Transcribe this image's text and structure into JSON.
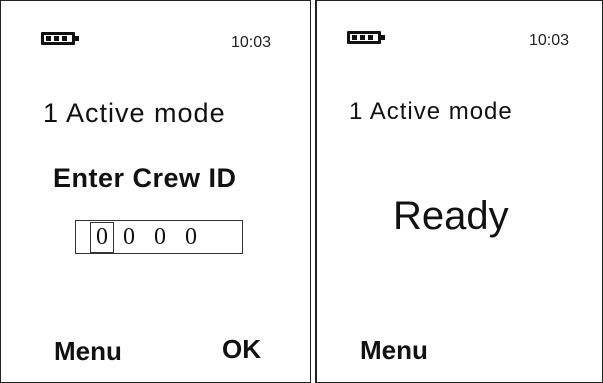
{
  "left_screen": {
    "time": "10:03",
    "mode_title": "1 Active mode",
    "prompt": "Enter Crew ID",
    "crew_id_digits": [
      "0",
      "0",
      "0",
      "0"
    ],
    "softkey_left": "Menu",
    "softkey_right": "OK"
  },
  "right_screen": {
    "time": "10:03",
    "mode_title": "1 Active mode",
    "status": "Ready",
    "softkey_left": "Menu"
  }
}
